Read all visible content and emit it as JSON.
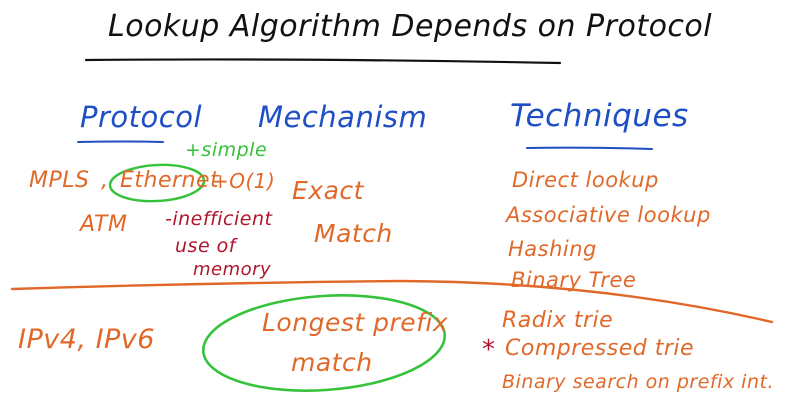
{
  "title": "Lookup Algorithm Depends on Protocol",
  "headers": {
    "protocol": "Protocol",
    "mechanism": "Mechanism",
    "techniques": "Techniques"
  },
  "exact_row": {
    "mpls": "MPLS",
    "comma": ",",
    "ethernet": "Ethernet",
    "pro_note": "+simple",
    "order_note": "+O(1)",
    "atm": "ATM",
    "con_note_1": "-inefficient",
    "con_note_2": "use of",
    "con_note_3": "memory",
    "mechanism_1": "Exact",
    "mechanism_2": "Match",
    "techniques": [
      "Direct lookup",
      "Associative lookup",
      "Hashing",
      "Binary Tree"
    ]
  },
  "prefix_row": {
    "protocols": "IPv4, IPv6",
    "mechanism_1": "Longest prefix",
    "mechanism_2": "match",
    "star": "*",
    "techniques": [
      "Radix trie",
      "Compressed trie",
      "Binary search on prefix int."
    ]
  },
  "colors": {
    "title": "#111111",
    "headers": "#1f4fc4",
    "content": "#e0692a",
    "highlight": "#36c23a",
    "note": "#b0152c"
  }
}
